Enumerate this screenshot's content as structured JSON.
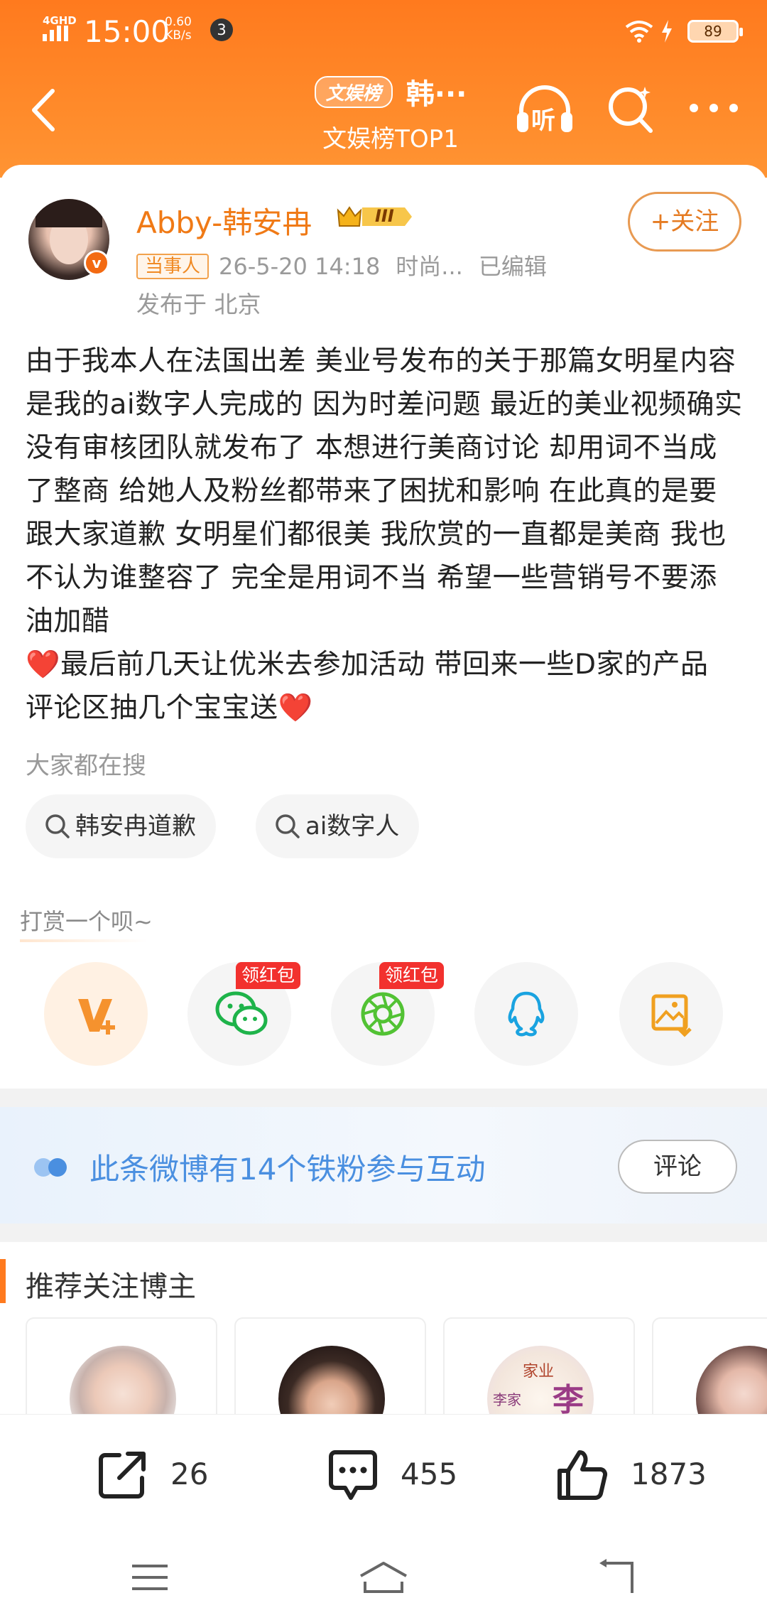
{
  "status_bar": {
    "network": "4GHD",
    "time": "15:00",
    "speed_value": "0.60",
    "speed_unit": "KB/s",
    "notification_count": "3",
    "battery": "89"
  },
  "header": {
    "badge": "文娱榜",
    "title": "韩···",
    "subtitle": "文娱榜TOP1",
    "listen_label": "听"
  },
  "post": {
    "author": "Abby-韩安冉",
    "level_badge": "III",
    "follow_label": "+关注",
    "role_tag": "当事人",
    "timestamp": "26-5-20 14:18",
    "source": "时尚...",
    "edited": "已编辑",
    "location": "发布于 北京",
    "text_main": "由于我本人在法国出差 美业号发布的关于那篇女明星内容 是我的ai数字人完成的 因为时差问题 最近的美业视频确实没有审核团队就发布了 本想进行美商讨论 却用词不当成了整商 给她人及粉丝都带来了困扰和影响 在此真的是要跟大家道歉 女明星们都很美 我欣赏的一直都是美商 我也不认为谁整容了 完全是用词不当 希望一些营销号不要添油加醋",
    "heart": "❤️",
    "text_tail": "最后前几天让优米去参加活动 带回来一些D家的产品 评论区抽几个宝宝送"
  },
  "search_section": {
    "label": "大家都在搜",
    "chips": [
      "韩安冉道歉",
      "ai数字人"
    ]
  },
  "tip_section": {
    "label": "打赏一个呗~",
    "redpack_label": "领红包",
    "buttons": [
      "vplus-icon",
      "wechat-icon",
      "moments-icon",
      "qq-icon",
      "save-image-icon"
    ]
  },
  "fans_bar": {
    "text": "此条微博有14个铁粉参与互动",
    "comment_label": "评论"
  },
  "recommend": {
    "title": "推荐关注博主",
    "card3_text_a": "家业",
    "card3_text_b": "李家",
    "card3_text_c": "李"
  },
  "actions": {
    "repost_count": "26",
    "comment_count": "455",
    "like_count": "1873"
  },
  "colors": {
    "brand_orange": "#ff7a1e",
    "name_orange": "#f07a16",
    "link_blue": "#4a8fe0"
  }
}
